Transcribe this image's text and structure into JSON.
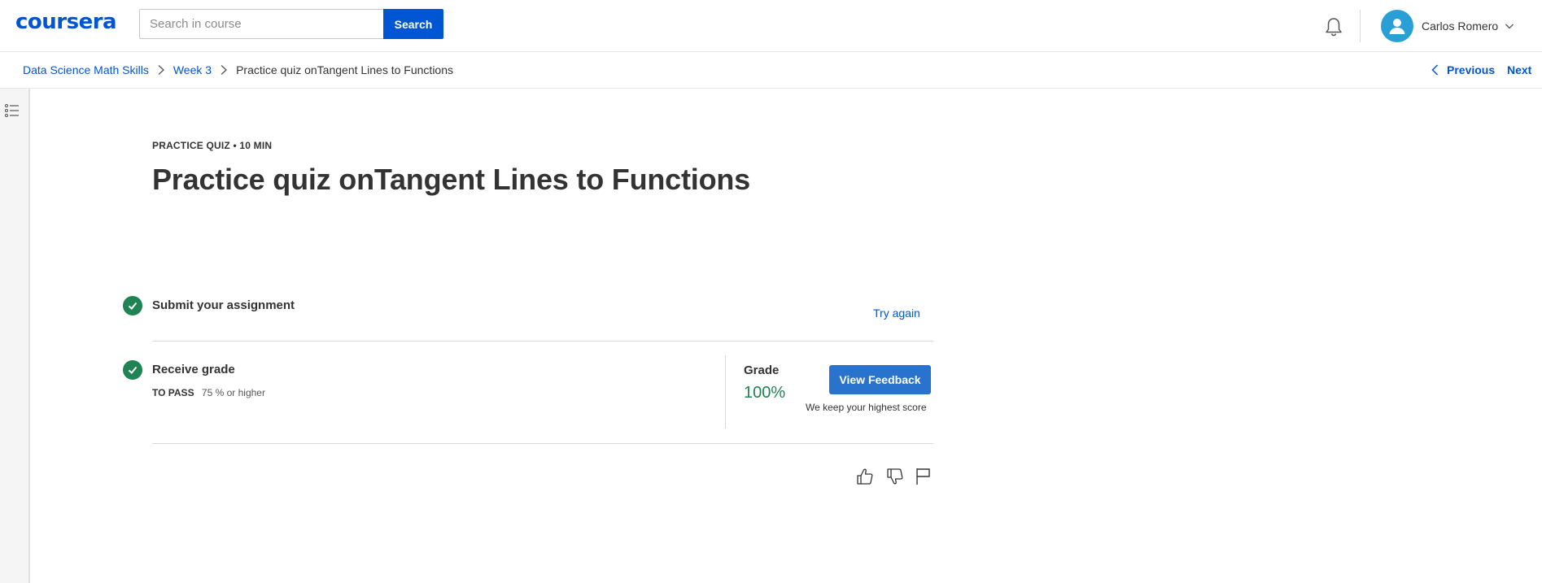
{
  "header": {
    "logo": "coursera",
    "search": {
      "placeholder": "Search in course",
      "value": "",
      "button_label": "Search"
    },
    "user": {
      "name": "Carlos Romero"
    },
    "icons": {
      "notifications": "bell-icon",
      "avatar": "user-avatar-icon",
      "menu": "chevron-down-icon"
    }
  },
  "breadcrumb": {
    "items": [
      "Data Science Math Skills",
      "Week 3",
      "Practice quiz onTangent Lines to Functions"
    ],
    "prev_label": "Previous",
    "next_label": "Next"
  },
  "content": {
    "eyebrow": "PRACTICE QUIZ • 10 MIN",
    "title": "Practice quiz onTangent Lines to Functions",
    "steps": [
      {
        "label": "Submit your assignment",
        "completed": true,
        "action": "Try again"
      },
      {
        "label": "Receive grade",
        "completed": true,
        "pass_label": "TO PASS",
        "pass_value": "75 % or higher"
      }
    ],
    "grade": {
      "label": "Grade",
      "value": "100%",
      "button_label": "View Feedback",
      "note": "We keep your highest score"
    },
    "feedback_icons": [
      "thumbs-up-icon",
      "thumbs-down-icon",
      "flag-icon"
    ]
  },
  "colors": {
    "brand": "#0056d2",
    "success": "#1f8354",
    "button": "#2a73cc",
    "text": "#333333"
  }
}
